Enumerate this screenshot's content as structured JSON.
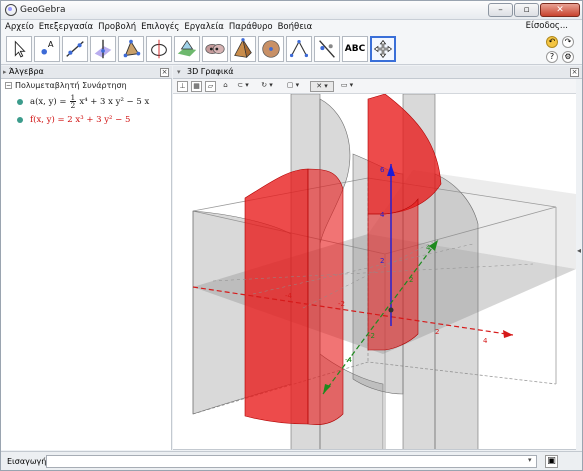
{
  "window": {
    "title": "GeoGebra",
    "minimize": "–",
    "maximize": "▫",
    "close": "✕"
  },
  "menu": {
    "items": [
      "Αρχείο",
      "Επεξεργασία",
      "Προβολή",
      "Επιλογές",
      "Εργαλεία",
      "Παράθυρο",
      "Βοήθεια"
    ],
    "signin": "Είσοδος..."
  },
  "toolbar": {
    "tools": [
      "move-tool",
      "point-tool",
      "line-tool",
      "perpendicular-tool",
      "polygon-tool",
      "circle-tool",
      "plane-tool",
      "intersect-tool",
      "pyramid-tool",
      "sphere-tool",
      "angle-tool",
      "reflect-tool",
      "text-tool",
      "view-tool"
    ],
    "text_tool_label": "ABC",
    "undo": "↶",
    "redo": "↷",
    "help": "?",
    "settings": "⚙"
  },
  "algebra": {
    "header": "Άλγεβρα",
    "group_label": "Πολυμεταβλητή Συνάρτηση",
    "items": [
      {
        "name": "a(x, y)",
        "lhs": "a(x, y) =",
        "frac_num": "1",
        "frac_den": "2",
        "rhs": "x⁴ + 3 x y² − 5 x",
        "color": "#1a1a1a",
        "dot": "#3c9c8c"
      },
      {
        "name": "f(x, y)",
        "formula": "f(x, y) = 2 x³ + 3 y² − 5",
        "color": "#d01010",
        "dot": "#3c9c8c"
      }
    ],
    "close": "×"
  },
  "graphics3d": {
    "header": "3D Γραφικά",
    "close": "×",
    "axis_labels": {
      "z_top": "6",
      "z_4": "4",
      "z_2": "2",
      "x_4": "4",
      "x_2": "2",
      "y_4": "4",
      "y_2": "2",
      "y_neg4": "-4",
      "x_neg2": "-2",
      "x_neg4": "-4",
      "y_neg2": "-2"
    }
  },
  "inputbar": {
    "label": "Εισαγωγή:",
    "value": "",
    "help": "▣"
  },
  "colors": {
    "accent": "#3a6fd8",
    "surface_red": "#e81818",
    "surface_gray": "#8a8a8a",
    "z_axis": "#1b1bd8",
    "x_axis": "#d61a1a",
    "y_axis": "#1e8a1e"
  }
}
